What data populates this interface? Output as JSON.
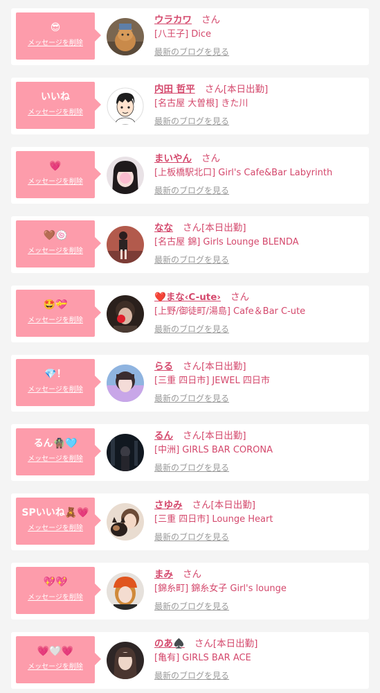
{
  "delete_label": "メッセージを削除",
  "blog_label": "最新のブログを見る",
  "accent_color": "#fd9cab",
  "text_color": "#d4486c",
  "cards": [
    {
      "message": "😎",
      "name": "ウラカワ",
      "san": "さん",
      "shop": "[八王子] Dice",
      "avatar": "cat-photo"
    },
    {
      "message": "いいね",
      "name": "内田 哲平",
      "san": "さん[本日出勤]",
      "shop": "[名古屋 大曽根] きた川",
      "avatar": "cartoon-man"
    },
    {
      "message": "💗",
      "name": "まいやん",
      "san": "さん",
      "shop": "[上板橋駅北口] Girl's Cafe&Bar Labyrinth",
      "avatar": "girl-photo"
    },
    {
      "message": "🤎🍥",
      "name": "なな",
      "san": "さん[本日出勤]",
      "shop": "[名古屋 錦] Girls Lounge BLENDA",
      "avatar": "girl-photo"
    },
    {
      "message": "🤩💝",
      "name_prefix": "❤️",
      "name": "まな‹C-ute›",
      "san": "さん",
      "shop": "[上野/御徒町/湯島] Cafe＆Bar C-ute",
      "avatar": "girl-photo"
    },
    {
      "message": "💎！",
      "name": "らる",
      "san": "さん[本日出勤]",
      "shop": "[三重 四日市] JEWEL 四日市",
      "avatar": "girl-photo"
    },
    {
      "message": "るん🧌🩵",
      "name": "るん",
      "san": "さん[本日出勤]",
      "shop": "[中洲] GIRLS BAR CORONA",
      "avatar": "night-photo"
    },
    {
      "message": "SPいいね🧸💗",
      "name": "さゆみ",
      "san": "さん[本日出勤]",
      "shop": "[三重 四日市] Lounge Heart",
      "avatar": "girl-with-dog-photo"
    },
    {
      "message": "💖💖",
      "name": "まみ",
      "san": "さん",
      "shop": "[錦糸町] 錦糸女子 Girl's lounge",
      "avatar": "girl-photo"
    },
    {
      "message": "💗🤍💗",
      "name": "のあ♠️",
      "san": "さん[本日出勤]",
      "shop": "[亀有] GIRLS BAR ACE",
      "avatar": "girl-photo"
    }
  ]
}
